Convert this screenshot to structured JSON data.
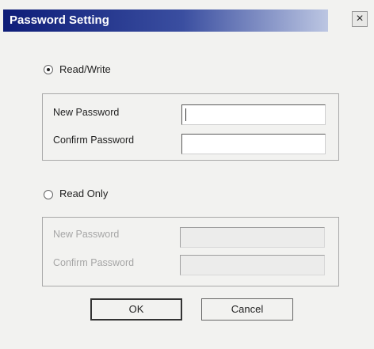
{
  "dialog": {
    "title": "Password Setting",
    "close_label": "×"
  },
  "read_write": {
    "label": "Read/Write",
    "selected": true,
    "new_password_label": "New Password",
    "confirm_password_label": "Confirm Password",
    "new_password_value": "",
    "confirm_password_value": ""
  },
  "read_only": {
    "label": "Read Only",
    "selected": false,
    "new_password_label": "New Password",
    "confirm_password_label": "Confirm Password",
    "new_password_value": "",
    "confirm_password_value": ""
  },
  "buttons": {
    "ok": "OK",
    "cancel": "Cancel"
  }
}
